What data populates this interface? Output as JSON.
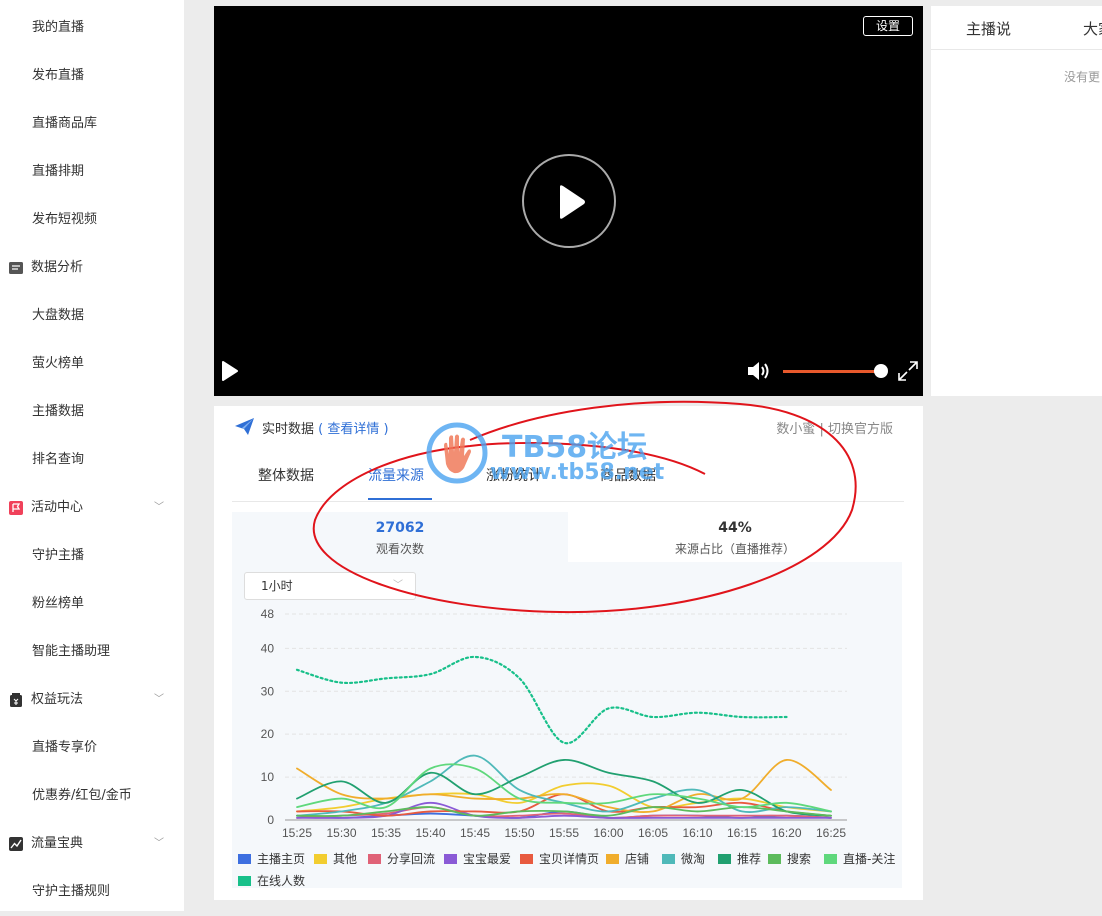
{
  "sidebar": {
    "items": [
      {
        "label": "我的直播",
        "type": "sub"
      },
      {
        "label": "发布直播",
        "type": "sub"
      },
      {
        "label": "直播商品库",
        "type": "sub"
      },
      {
        "label": "直播排期",
        "type": "sub"
      },
      {
        "label": "发布短视频",
        "type": "sub"
      },
      {
        "label": "数据分析",
        "type": "group",
        "icon": "report-icon"
      },
      {
        "label": "大盘数据",
        "type": "sub"
      },
      {
        "label": "萤火榜单",
        "type": "sub"
      },
      {
        "label": "主播数据",
        "type": "sub"
      },
      {
        "label": "排名查询",
        "type": "sub"
      },
      {
        "label": "活动中心",
        "type": "group",
        "icon": "flag-icon",
        "chevron": true
      },
      {
        "label": "守护主播",
        "type": "sub"
      },
      {
        "label": "粉丝榜单",
        "type": "sub"
      },
      {
        "label": "智能主播助理",
        "type": "sub"
      },
      {
        "label": "权益玩法",
        "type": "group",
        "icon": "gift-icon",
        "chevron": true
      },
      {
        "label": "直播专享价",
        "type": "sub"
      },
      {
        "label": "优惠券/红包/金币",
        "type": "sub"
      },
      {
        "label": "流量宝典",
        "type": "group",
        "icon": "trend-icon",
        "chevron": true
      },
      {
        "label": "守护主播规则",
        "type": "sub"
      }
    ]
  },
  "video": {
    "settings_label": "设置",
    "volume_level": 0.9
  },
  "right_panel": {
    "tabs": [
      "主播说",
      "大家"
    ],
    "empty_text": "没有更"
  },
  "data_panel": {
    "title": "实时数据",
    "detail_link": "( 查看详情 )",
    "right_links": "数小蜜  |  切换官方版",
    "tabs": [
      "整体数据",
      "流量来源",
      "涨粉统计",
      "商品数据"
    ],
    "active_tab": 1,
    "stats": [
      {
        "value": "27062",
        "label": "观看次数",
        "color": "#2f6fd6"
      },
      {
        "value": "44%",
        "label": "来源占比（直播推荐）",
        "color": "#333333"
      }
    ],
    "range_select": "1小时"
  },
  "watermark": {
    "line1": "TB58论坛",
    "line2": "www.tb58.net"
  },
  "chart_data": {
    "type": "line",
    "x": [
      "15:25",
      "15:30",
      "15:35",
      "15:40",
      "15:45",
      "15:50",
      "15:55",
      "16:00",
      "16:05",
      "16:10",
      "16:15",
      "16:20",
      "16:25"
    ],
    "ylim": [
      0,
      48
    ],
    "yticks": [
      0,
      10,
      20,
      30,
      40,
      48
    ],
    "grid": true,
    "legend_position": "bottom",
    "series": [
      {
        "name": "主播主页",
        "color": "#3d6fe0",
        "values": [
          1,
          0.5,
          1,
          1.5,
          1,
          0.5,
          2,
          0.5,
          1,
          1,
          0.5,
          1,
          0.5
        ]
      },
      {
        "name": "其他",
        "color": "#f2cd2f",
        "values": [
          2,
          3,
          5,
          6,
          6,
          4,
          8,
          8,
          3,
          4,
          5,
          3,
          2
        ]
      },
      {
        "name": "分享回流",
        "color": "#e06277",
        "values": [
          0.5,
          1,
          1.5,
          3,
          1,
          1,
          1.5,
          0.5,
          1,
          1,
          1,
          1,
          0.5
        ]
      },
      {
        "name": "宝宝最爱",
        "color": "#8a5ad6",
        "values": [
          0.5,
          0.5,
          1,
          4,
          1,
          0.5,
          1,
          0.5,
          0.5,
          0.5,
          0.5,
          0.5,
          0.5
        ]
      },
      {
        "name": "宝贝详情页",
        "color": "#e85a3f",
        "values": [
          2,
          2,
          1,
          2,
          2,
          2,
          6,
          2,
          3,
          3,
          4,
          2,
          1
        ]
      },
      {
        "name": "店铺",
        "color": "#f0ad2c",
        "values": [
          12,
          6,
          5,
          6,
          5,
          5,
          6,
          3,
          2,
          6,
          5,
          14,
          7
        ]
      },
      {
        "name": "微淘",
        "color": "#4fb9b9",
        "values": [
          1,
          2,
          4,
          9,
          15,
          7,
          4,
          2,
          5,
          7,
          2,
          3,
          2
        ]
      },
      {
        "name": "推荐",
        "color": "#21a070",
        "values": [
          5,
          9,
          4,
          11,
          6,
          10,
          14,
          11,
          9,
          4,
          7,
          2,
          1
        ]
      },
      {
        "name": "搜索",
        "color": "#5cbb5c",
        "values": [
          1,
          1,
          2,
          3,
          1,
          2,
          2,
          1,
          3,
          2,
          3,
          2,
          1
        ]
      },
      {
        "name": "直播-关注",
        "color": "#5fd87c",
        "values": [
          3,
          5,
          3,
          12,
          12,
          5,
          4,
          4,
          6,
          5,
          3,
          4,
          2
        ]
      },
      {
        "name": "在线人数",
        "color": "#18c08a",
        "dashed": true,
        "values": [
          35,
          32,
          33,
          34,
          38,
          33,
          18,
          26,
          24,
          25,
          24,
          24,
          null
        ]
      }
    ]
  }
}
